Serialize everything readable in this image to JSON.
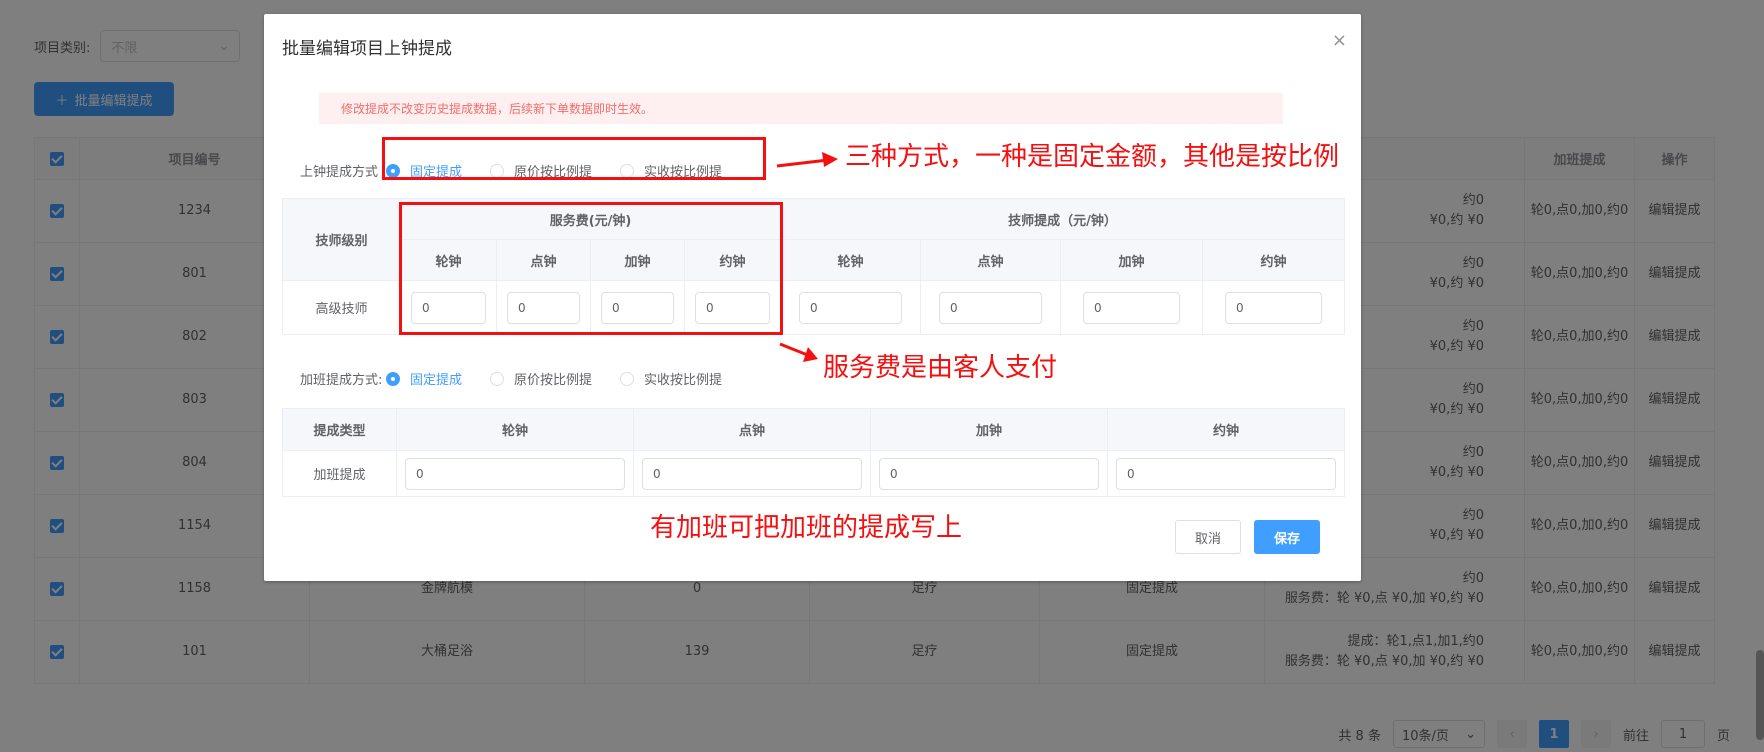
{
  "background": {
    "filter_label": "项目类别:",
    "filter_value": "不限",
    "batch_button": "批量编辑提成",
    "columns": [
      "项目编号",
      "加班提成",
      "操作"
    ],
    "rows": [
      {
        "id": "1234",
        "detail1": "约0",
        "detail2": "¥0,约 ¥0",
        "overtime": "轮0,点0,加0,约0",
        "action": "编辑提成"
      },
      {
        "id": "801",
        "detail1": "约0",
        "detail2": "¥0,约 ¥0",
        "overtime": "轮0,点0,加0,约0",
        "action": "编辑提成"
      },
      {
        "id": "802",
        "detail1": "约0",
        "detail2": "¥0,约 ¥0",
        "overtime": "轮0,点0,加0,约0",
        "action": "编辑提成"
      },
      {
        "id": "803",
        "detail1": "约0",
        "detail2": "¥0,约 ¥0",
        "overtime": "轮0,点0,加0,约0",
        "action": "编辑提成"
      },
      {
        "id": "804",
        "detail1": "约0",
        "detail2": "¥0,约 ¥0",
        "overtime": "轮0,点0,加0,约0",
        "action": "编辑提成"
      },
      {
        "id": "1154",
        "detail1": "约0",
        "detail2": "¥0,约 ¥0",
        "overtime": "轮0,点0,加0,约0",
        "action": "编辑提成"
      },
      {
        "id": "1158",
        "name": "金牌航模",
        "price": "0",
        "category": "足疗",
        "type": "固定提成",
        "detail1": "约0",
        "detail2": "服务费：轮 ¥0,点 ¥0,加 ¥0,约 ¥0",
        "overtime": "轮0,点0,加0,约0",
        "action": "编辑提成"
      },
      {
        "id": "101",
        "name": "大桶足浴",
        "price": "139",
        "category": "足疗",
        "type": "固定提成",
        "detail1": "提成：轮1,点1,加1,约0",
        "detail2": "服务费：轮 ¥0,点 ¥0,加 ¥0,约 ¥0",
        "overtime": "轮0,点0,加0,约0",
        "action": "编辑提成"
      }
    ],
    "pagination": {
      "total": "共 8 条",
      "page_size": "10条/页",
      "current_page": "1",
      "jump_label": "前往",
      "jump_value": "1",
      "page_unit": "页"
    }
  },
  "dialog": {
    "title": "批量编辑项目上钟提成",
    "close": "×",
    "notice": "修改提成不改变历史提成数据，后续新下单数据即时生效。",
    "clock_mode": {
      "label": "上钟提成方式",
      "options": [
        "固定提成",
        "原价按比例提",
        "实收按比例提"
      ],
      "selected": "固定提成"
    },
    "commission_table": {
      "level_header": "技师级别",
      "group_service": "服务费(元/钟)",
      "group_tech": "技师提成（元/钟）",
      "sub_headers": [
        "轮钟",
        "点钟",
        "加钟",
        "约钟"
      ],
      "row_label": "高级技师",
      "service_values": [
        "0",
        "0",
        "0",
        "0"
      ],
      "tech_values": [
        "0",
        "0",
        "0",
        "0"
      ]
    },
    "overtime_mode": {
      "label": "加班提成方式:",
      "options": [
        "固定提成",
        "原价按比例提",
        "实收按比例提"
      ],
      "selected": "固定提成"
    },
    "overtime_table": {
      "type_header": "提成类型",
      "sub_headers": [
        "轮钟",
        "点钟",
        "加钟",
        "约钟"
      ],
      "row_label": "加班提成",
      "values": [
        "0",
        "0",
        "0",
        "0"
      ]
    },
    "cancel": "取消",
    "save": "保存"
  },
  "annotations": {
    "note1": "三种方式，一种是固定金额，其他是按比例",
    "note2": "服务费是由客人支付",
    "note3": "有加班可把加班的提成写上",
    "color": "#f41010"
  }
}
